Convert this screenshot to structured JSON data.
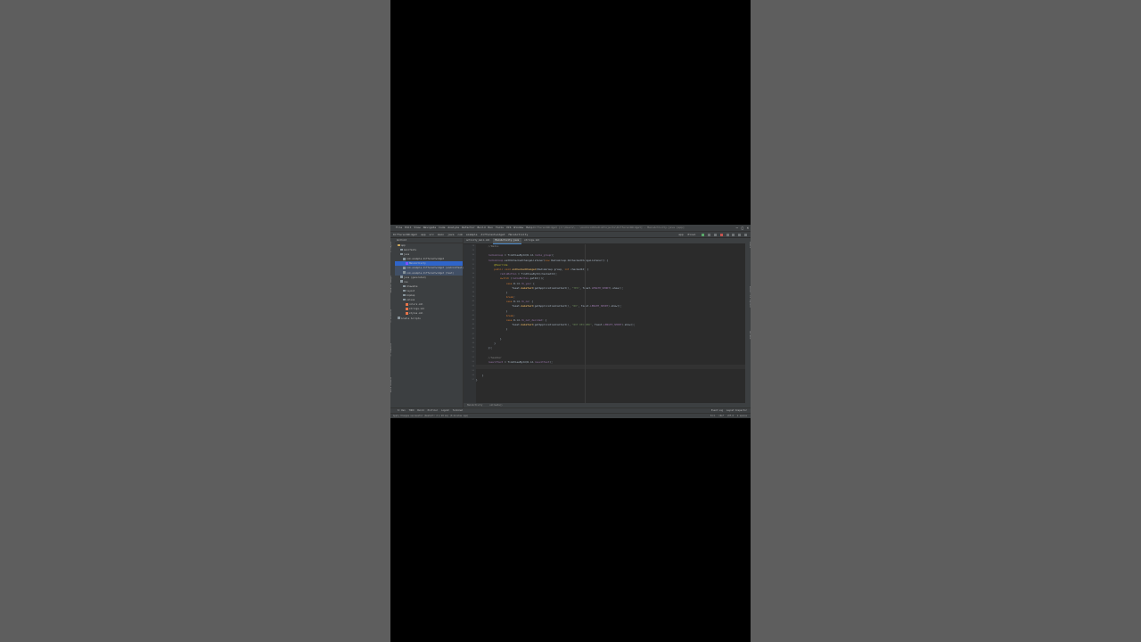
{
  "window": {
    "menu": [
      "File",
      "Edit",
      "View",
      "Navigate",
      "Code",
      "Analyze",
      "Refactor",
      "Build",
      "Run",
      "Tools",
      "VCS",
      "Window",
      "Help"
    ],
    "title_path": "DifferentWidget [C:\\Users\\...\\AndroidStudioProjects\\DifferentWidget] - MainActivity.java [app]"
  },
  "navbar": {
    "crumbs": [
      "DifferentWidget",
      "app",
      "src",
      "main",
      "java",
      "com",
      "example",
      "differentwidget",
      "MainActivity"
    ],
    "run_config": "app",
    "device": "Pixel"
  },
  "project_panel": {
    "header": "Android",
    "items": [
      {
        "label": "app",
        "indent": 1,
        "icon": "fold y"
      },
      {
        "label": "manifests",
        "indent": 2,
        "icon": "fold"
      },
      {
        "label": "java",
        "indent": 2,
        "icon": "fold"
      },
      {
        "label": "com.example.differentwidget",
        "indent": 3,
        "icon": "fold"
      },
      {
        "label": "MainActivity",
        "indent": 4,
        "icon": "kt",
        "state": "sel"
      },
      {
        "label": "com.example.differentwidget (androidTest)",
        "indent": 3,
        "icon": "fold",
        "state": "hl"
      },
      {
        "label": "com.example.differentwidget (test)",
        "indent": 3,
        "icon": "fold",
        "state": "hl"
      },
      {
        "label": "java (generated)",
        "indent": 2,
        "icon": "fold"
      },
      {
        "label": "res",
        "indent": 2,
        "icon": "fold"
      },
      {
        "label": "drawable",
        "indent": 3,
        "icon": "fold"
      },
      {
        "label": "layout",
        "indent": 3,
        "icon": "fold"
      },
      {
        "label": "mipmap",
        "indent": 3,
        "icon": "fold"
      },
      {
        "label": "values",
        "indent": 3,
        "icon": "fold"
      },
      {
        "label": "colors.xml",
        "indent": 4,
        "icon": "xml"
      },
      {
        "label": "strings.xml",
        "indent": 4,
        "icon": "xml"
      },
      {
        "label": "styles.xml",
        "indent": 4,
        "icon": "xml"
      },
      {
        "label": "Gradle Scripts",
        "indent": 1,
        "icon": "fold"
      }
    ]
  },
  "tabs": [
    {
      "label": "activity_main.xml",
      "active": false
    },
    {
      "label": "MainActivity.java",
      "active": true
    },
    {
      "label": "strings.xml",
      "active": false
    }
  ],
  "code_lines": [
    {
      "n": "28",
      "html": "        <span class='cm'>//Radio</span>"
    },
    {
      "n": "29",
      "html": ""
    },
    {
      "n": "30",
      "html": "        <span class='fld'>radioGroup</span> = findViewById(R.id.<span class='fld'>radio_group</span>);"
    },
    {
      "n": "31",
      "html": "        <span class='fld'>radioGroup</span>.setOnCheckedChangeListener(<span class='kw'>new</span> RadioGroup.OnCheckedChangeListener() {"
    },
    {
      "n": "32",
      "html": "            <span class='an'>@Override</span>"
    },
    {
      "n": "33",
      "html": "            <span class='kw'>public void</span> <span class='fn'>onCheckedChanged</span>(RadioGroup group, <span class='kw'>int</span> checkedId) {"
    },
    {
      "n": "34",
      "html": "                <span class='fld'>radioButton</span> = findViewById(checkedId);"
    },
    {
      "n": "35",
      "html": "                <span class='kw'>switch</span> (<span class='fld'>radioButton</span>.getId()){"
    },
    {
      "n": "36",
      "html": "                    <span class='kw'>case</span> R.id.<span class='fld'>rb_yes</span>: {"
    },
    {
      "n": "37",
      "html": "                        Toast.<span class='fn'>makeText</span>(getApplicationContext(), <span class='str'>\"YES\"</span>, Toast.<span class='fld'>LENGTH_SHORT</span>).show();"
    },
    {
      "n": "38",
      "html": "                    }"
    },
    {
      "n": "39",
      "html": "                    <span class='kw'>break</span>;"
    },
    {
      "n": "40",
      "html": "                    <span class='kw'>case</span> R.id.<span class='fld'>rb_no</span>: {"
    },
    {
      "n": "41",
      "html": "                        Toast.<span class='fn'>makeText</span>(getApplicationContext(), <span class='str'>\"NO\"</span>, Toast.<span class='fld'>LENGTH_SHORT</span>).show();"
    },
    {
      "n": "42",
      "html": "                    }"
    },
    {
      "n": "43",
      "html": "                    <span class='kw'>break</span>;"
    },
    {
      "n": "44",
      "html": "                    <span class='kw'>case</span> R.id.<span class='fld'>rb_not_decided</span>: {"
    },
    {
      "n": "45",
      "html": "                        Toast.<span class='fn'>makeText</span>(getApplicationContext(), <span class='str'>\"NOT DECIDED\"</span>, Toast.<span class='fld'>LENGTH_SHORT</span>).show();"
    },
    {
      "n": "46",
      "html": "                    }"
    },
    {
      "n": "47",
      "html": ""
    },
    {
      "n": "48",
      "html": "                }"
    },
    {
      "n": "49",
      "html": "            }"
    },
    {
      "n": "50",
      "html": "        });"
    },
    {
      "n": "51",
      "html": ""
    },
    {
      "n": "52",
      "html": "        <span class='cm'>//Seekbar</span>"
    },
    {
      "n": "53",
      "html": "        <span class='fld'>resultText</span> = findViewById(R.id.<span class='fld'>resultText</span>);"
    },
    {
      "n": "54",
      "html": "",
      "cur": true
    },
    {
      "n": "55",
      "html": ""
    },
    {
      "n": "56",
      "html": "    }"
    },
    {
      "n": "57",
      "html": "}"
    }
  ],
  "bottom_tabs": [
    "MainActivity",
    "onCreate()"
  ],
  "tool_windows": [
    "6: Run",
    "TODO",
    "Build",
    "Profiler",
    "Logcat",
    "Terminal"
  ],
  "tool_windows_right": [
    "Event Log",
    "Layout Inspector"
  ],
  "status": {
    "message": "Apply Changes successful (Restart: 2 s 28 ms) (8 minutes ago)",
    "right": [
      "54:1",
      "CRLF",
      "UTF-8",
      "4 spaces"
    ]
  },
  "left_strip": [
    "1: Project",
    "Resource Manager",
    "Z: Structure",
    "2: Favorites",
    "Build Variants"
  ],
  "right_strip": [
    "Gradle",
    "Device File Explorer",
    "Emulator"
  ]
}
